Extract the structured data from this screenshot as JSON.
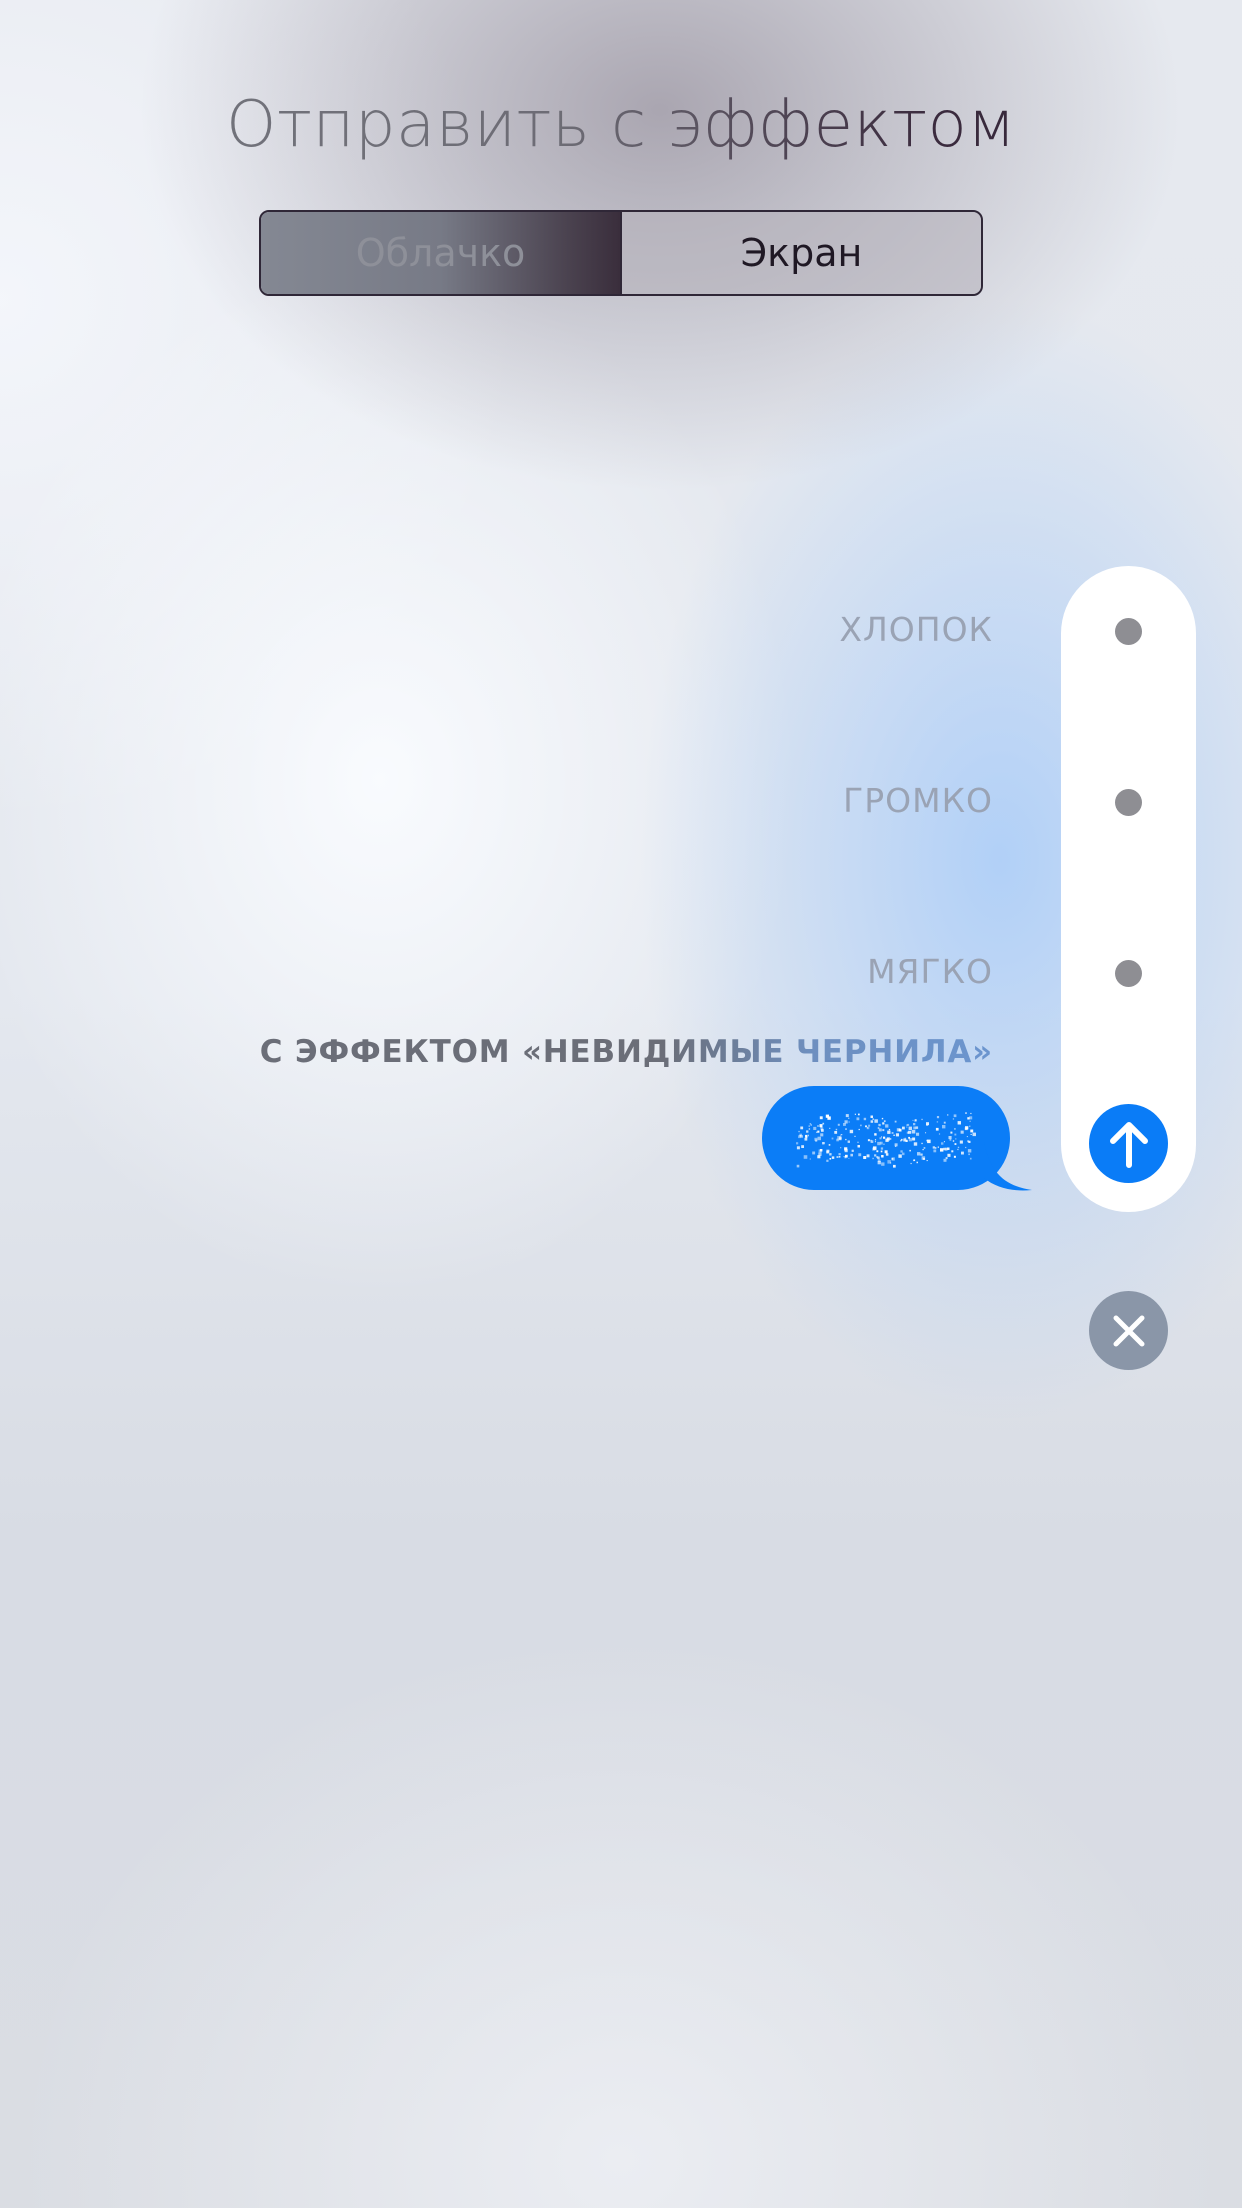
{
  "header": {
    "title": "Отправить с эффектом"
  },
  "tabs": {
    "bubble_label": "Облачко",
    "screen_label": "Экран",
    "selected": "Облачко"
  },
  "effects": {
    "slam_label": "ХЛОПОК",
    "loud_label": "ГРОМКО",
    "gentle_label": "МЯГКО",
    "selected_caption": "С ЭФФЕКТОМ «НЕВИДИМЫЕ ЧЕРНИЛА»"
  },
  "icons": {
    "send": "arrow-up-icon",
    "close": "close-x-icon"
  },
  "colors": {
    "accent_blue": "#0a7cf7",
    "close_gray": "#8a96a8",
    "dot_gray": "#8e8e93"
  }
}
